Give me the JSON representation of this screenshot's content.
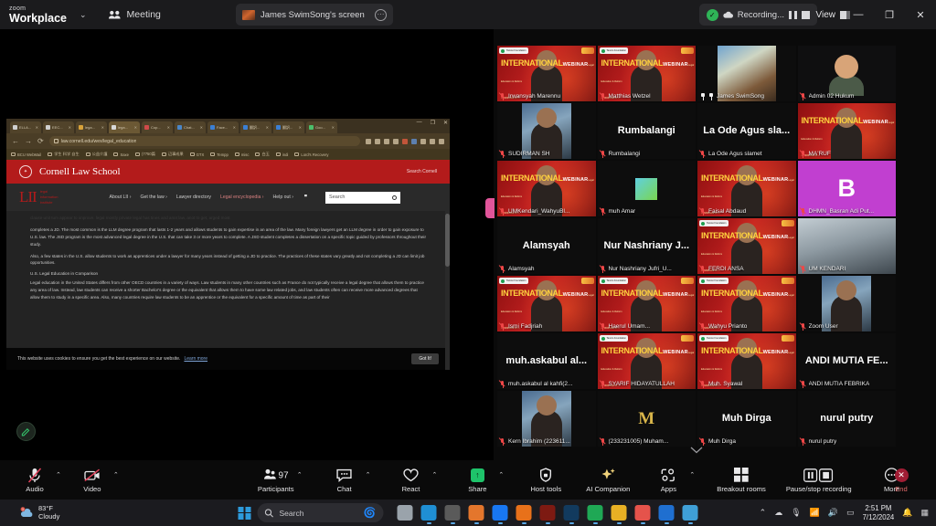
{
  "titlebar": {
    "brand_small": "zoom",
    "brand_big": "Workplace",
    "caret": "⌄",
    "meeting_label": "Meeting",
    "share_label": "James SwimSong's screen",
    "share_more_icon": "more-horizontal-icon",
    "recording_label": "Recording...",
    "view_label": "View",
    "minimize": "—",
    "maximize": "❐",
    "close": "✕"
  },
  "browser": {
    "tabs": [
      {
        "title": "Goo..."
      },
      {
        "title": "翻訳..."
      },
      {
        "title": "翻訳..."
      },
      {
        "title": "Face..."
      },
      {
        "title": "Chat..."
      },
      {
        "title": "Cop..."
      },
      {
        "title": "lega..."
      },
      {
        "title": "lega..."
      },
      {
        "title": "EEC..."
      },
      {
        "title": "ELLA..."
      }
    ],
    "new_tab": "+",
    "url": "law.cornell.edu/wex/legal_education",
    "bookmarks": [
      "BCU WebMail",
      "学生 科学 自生",
      "公益介護",
      "Saxe",
      "(7750篇",
      "辺事成果",
      "GTX",
      "Tempp",
      "misc",
      "白玉",
      "indi",
      "Lord's Recovery"
    ],
    "bookmark_overflow": "»",
    "bookmark_last": "本社長期"
  },
  "site": {
    "brand": "Cornell Law School",
    "search_link": "Search Cornell",
    "lii_logo": "LII",
    "lii_sub_lines": [
      "legal",
      "information",
      "institute"
    ],
    "nav": [
      {
        "label": "About LII ›",
        "accent": false
      },
      {
        "label": "Get the law ›",
        "accent": false
      },
      {
        "label": "Lawyer directory",
        "accent": false
      },
      {
        "label": "Legal encyclopedia ›",
        "accent": true
      },
      {
        "label": "Help out ›",
        "accent": false
      }
    ],
    "search_placeholder": "Search",
    "paragraphs": [
      "completes a JD. The most common is the LLM degree program that lasts 1-2 years and allows students to gain expertise in an area of the law. Many foreign lawyers get an LLM degree in order to gain exposure to U.S. law. The JSD program is the most advanced legal degree in the U.S. that can take 3 or more years to complete. A JSD student completes a dissertation on a specific topic guided by professors throughout their study.",
      "Also, a few states in the U.S. allow students to work as apprentices under a lawyer for many years instead of getting a JD to practice. The practices of these states vary greatly and not completing a JD can limit job opportunities."
    ],
    "subheading": "U.S. Legal Education in Comparison",
    "paragraph_comparison": "Legal education in the United States differs from other OECD countries in a variety of ways. Law students in many other countries such as France do not typically receive a legal degree that allows them to practice any area of law. Instead, law students can receive a shorter Bachelor's degree or the equivalent that allows them to have some law related jobs, and law students often can receive more advanced degrees that allow them to study in a specific area. Also, many countries require law students to be an apprentice or the equivalent for a specific amount of time as part of their",
    "cookie_text": "This website uses cookies to ensure you get the best experience on our website.",
    "cookie_link": "Learn more",
    "cookie_button": "Got It!"
  },
  "annotate": {
    "icon": "pencil-icon"
  },
  "gallery": {
    "more_icon": "chevron-down-icon",
    "participants": [
      {
        "name": "Irwansyah Marennu",
        "bg": "webinar",
        "badge": true,
        "big": null,
        "speaking": false,
        "muted": true
      },
      {
        "name": "Matthias Wetzel",
        "bg": "webinar",
        "badge": true,
        "big": null,
        "speaking": false,
        "muted": true
      },
      {
        "name": "James SwimSong",
        "bg": "street",
        "badge": false,
        "big": null,
        "speaking": true,
        "muted": false
      },
      {
        "name": "Admin 02 Hukum",
        "bg": "avatar",
        "badge": false,
        "big": null,
        "speaking": false,
        "muted": true
      },
      {
        "name": "SUDIRMAN SH",
        "bg": "photo",
        "badge": false,
        "big": null,
        "speaking": false,
        "muted": true
      },
      {
        "name": "Rumbalangi",
        "bg": "dark",
        "badge": false,
        "big": "Rumbalangi",
        "speaking": false,
        "muted": true
      },
      {
        "name": "La Ode Agus slamet",
        "bg": "dark",
        "badge": false,
        "big": "La Ode Agus sla...",
        "speaking": false,
        "muted": true
      },
      {
        "name": "MA'RUF",
        "bg": "webinar",
        "badge": false,
        "big": null,
        "speaking": false,
        "muted": true
      },
      {
        "name": "UMKendari_WahyuBl...",
        "bg": "webinar",
        "badge": false,
        "big": null,
        "speaking": false,
        "muted": true
      },
      {
        "name": "muh Amar",
        "bg": "square",
        "badge": false,
        "big": null,
        "speaking": false,
        "muted": true
      },
      {
        "name": "Faisal Abdaud",
        "bg": "webinar",
        "badge": false,
        "big": null,
        "speaking": false,
        "muted": true
      },
      {
        "name": "DHMN_Basran Adi Put...",
        "bg": "initial",
        "initial": "B",
        "badge": false,
        "big": null,
        "speaking": false,
        "muted": true
      },
      {
        "name": "Alamsyah",
        "bg": "dark",
        "badge": false,
        "big": "Alamsyah",
        "speaking": false,
        "muted": true
      },
      {
        "name": "Nur Nashriany Jufri_U...",
        "bg": "dark",
        "badge": false,
        "big": "Nur Nashriany J...",
        "speaking": false,
        "muted": true
      },
      {
        "name": "FERDI ANSA",
        "bg": "webinar",
        "badge": true,
        "big": null,
        "speaking": false,
        "muted": true
      },
      {
        "name": "UM KENDARI",
        "bg": "room",
        "badge": false,
        "big": null,
        "speaking": false,
        "muted": true
      },
      {
        "name": "Ismi Fadjriah",
        "bg": "webinar",
        "badge": true,
        "big": null,
        "speaking": false,
        "muted": true
      },
      {
        "name": "Haerul Umam...",
        "bg": "webinar",
        "badge": true,
        "big": null,
        "speaking": false,
        "muted": true
      },
      {
        "name": "Wahyu Prianto",
        "bg": "webinar",
        "badge": true,
        "big": null,
        "speaking": false,
        "muted": true
      },
      {
        "name": "Zoom User",
        "bg": "photo",
        "badge": false,
        "big": null,
        "speaking": false,
        "muted": true
      },
      {
        "name": "muh.askabul al kahfi(2...",
        "bg": "dark",
        "badge": false,
        "big": "muh.askabul  al...",
        "speaking": false,
        "muted": true
      },
      {
        "name": "SYARIF HIDAYATULLAH",
        "bg": "webinar",
        "badge": true,
        "big": null,
        "speaking": false,
        "muted": true
      },
      {
        "name": "Muh. Syawal",
        "bg": "webinar",
        "badge": true,
        "big": null,
        "speaking": false,
        "muted": true
      },
      {
        "name": "ANDI MUTIA FEBRIKA",
        "bg": "dark",
        "badge": false,
        "big": "ANDI MUTIA FE...",
        "speaking": false,
        "muted": true
      },
      {
        "name": "Kern Ibrahim (223611...",
        "bg": "photo",
        "badge": false,
        "big": null,
        "speaking": false,
        "muted": true
      },
      {
        "name": "(233231005) Muham...",
        "bg": "mt",
        "badge": false,
        "big": null,
        "speaking": false,
        "muted": true
      },
      {
        "name": "Muh Dirga",
        "bg": "dark",
        "badge": false,
        "big": "Muh Dirga",
        "speaking": false,
        "muted": true
      },
      {
        "name": "nurul putry",
        "bg": "dark",
        "badge": false,
        "big": "nurul putry",
        "speaking": false,
        "muted": true
      }
    ]
  },
  "toolbar": {
    "audio": {
      "label": "Audio",
      "icon": "microphone-muted-icon",
      "caret": true
    },
    "video": {
      "label": "Video",
      "icon": "camera-muted-icon",
      "caret": true
    },
    "participants": {
      "label": "Participants",
      "icon": "people-icon",
      "count": "97",
      "caret": true
    },
    "chat": {
      "label": "Chat",
      "icon": "chat-bubble-icon",
      "caret": true
    },
    "react": {
      "label": "React",
      "icon": "heart-icon",
      "caret": true
    },
    "share": {
      "label": "Share",
      "icon": "share-screen-icon",
      "caret": true
    },
    "host_tools": {
      "label": "Host tools",
      "icon": "shield-icon",
      "caret": false
    },
    "ai_companion": {
      "label": "AI Companion",
      "icon": "sparkle-icon",
      "caret": false
    },
    "apps": {
      "label": "Apps",
      "icon": "apps-icon",
      "caret": true
    },
    "breakout": {
      "label": "Breakout rooms",
      "icon": "grid-squares-icon",
      "caret": false
    },
    "recording": {
      "label": "Pause/stop recording",
      "icon": "pause-stop-icon",
      "caret": false
    },
    "more": {
      "label": "More",
      "icon": "ellipsis-icon",
      "caret": false
    },
    "end": {
      "label": "End",
      "icon": "end-call-icon",
      "caret": false
    }
  },
  "taskbar": {
    "weather_temp": "83°F",
    "weather_desc": "Cloudy",
    "start_icon": "windows-start-icon",
    "search_placeholder": "Search",
    "apps": [
      {
        "name": "task-view-icon",
        "color": "#9aa3ab"
      },
      {
        "name": "edge-icon",
        "color": "#1f8fd4"
      },
      {
        "name": "shareit-icon",
        "color": "#5a5a5a"
      },
      {
        "name": "imo-icon",
        "color": "#e4762c"
      },
      {
        "name": "facebook-icon",
        "color": "#1877f2"
      },
      {
        "name": "firefox-icon",
        "color": "#e8711a"
      },
      {
        "name": "illustrator-icon",
        "color": "#7d1a12"
      },
      {
        "name": "photoshop-icon",
        "color": "#123a5e"
      },
      {
        "name": "whatsapp-icon",
        "color": "#1fa855"
      },
      {
        "name": "file-explorer-icon",
        "color": "#e8b024"
      },
      {
        "name": "chrome-icon",
        "color": "#e5534b"
      },
      {
        "name": "zoom-icon",
        "color": "#1f6fd0"
      },
      {
        "name": "notes-icon",
        "color": "#3f9fd6"
      }
    ],
    "tray": [
      "chevron-up-icon",
      "onedrive-icon",
      "microphone-icon",
      "wifi-icon",
      "volume-icon",
      "battery-icon"
    ],
    "time": "2:51 PM",
    "date": "7/12/2024",
    "notification_icon": "bell-icon",
    "extra_icon": "widgets-icon"
  }
}
